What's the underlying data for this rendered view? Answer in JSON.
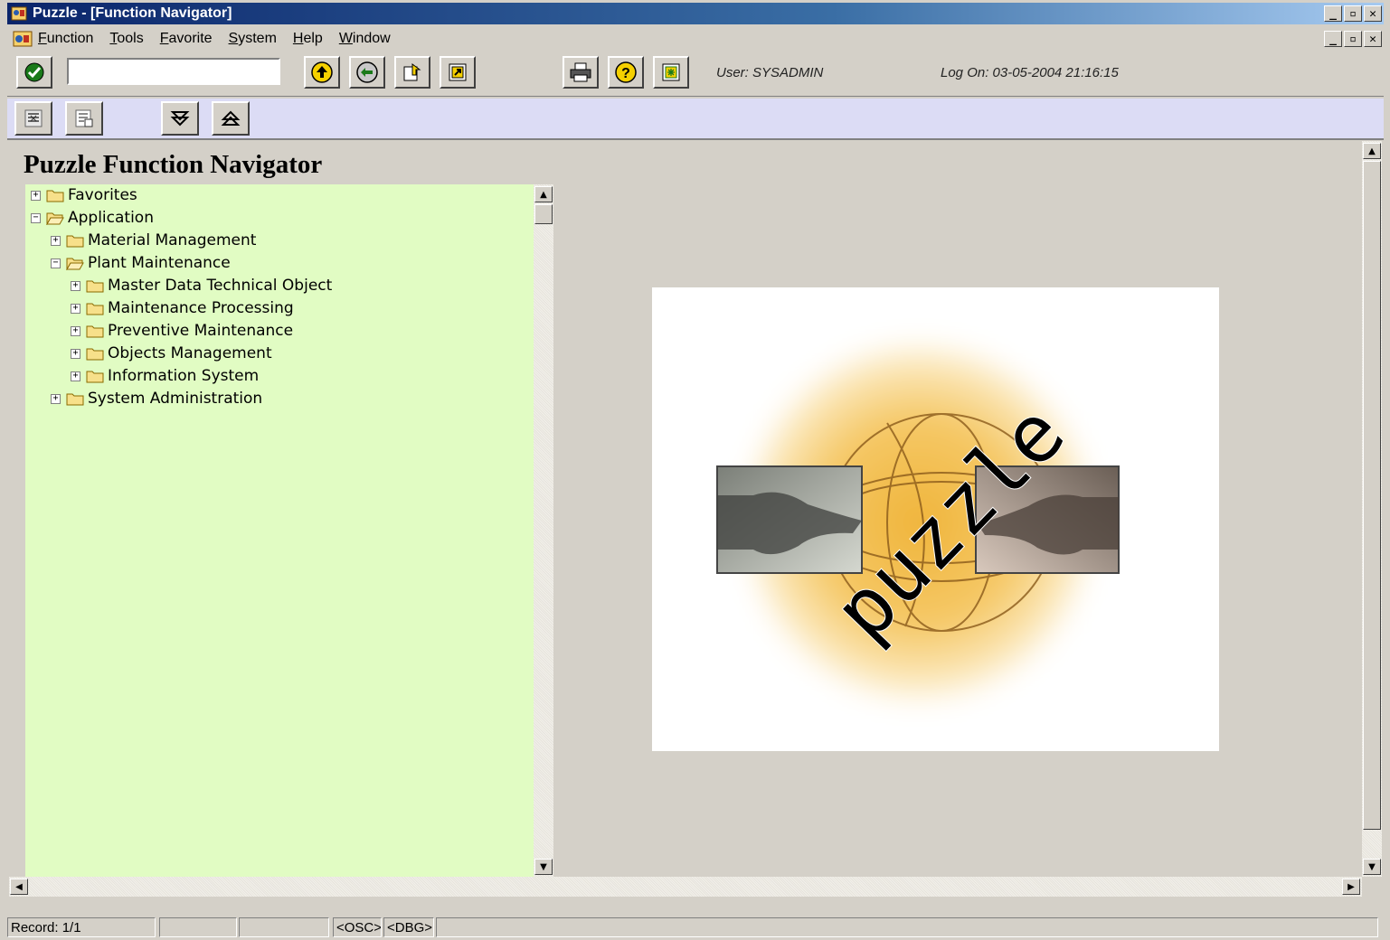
{
  "window": {
    "title": "Puzzle - [Function Navigator]"
  },
  "menu": {
    "items": [
      {
        "accel": "F",
        "rest": "unction"
      },
      {
        "accel": "T",
        "rest": "ools"
      },
      {
        "accel": "F",
        "rest": "avorite"
      },
      {
        "accel": "S",
        "rest": "ystem"
      },
      {
        "accel": "H",
        "rest": "elp"
      },
      {
        "accel": "W",
        "rest": "indow"
      }
    ]
  },
  "toolbar": {
    "command_value": "",
    "user_text": "User:  SYSADMIN",
    "logon_text": "Log On: 03-05-2004 21:16:15",
    "icons": [
      "check-icon",
      "back-icon",
      "exit-icon",
      "export-icon",
      "shortcut-icon",
      "print-icon",
      "help-icon",
      "layout-icon"
    ]
  },
  "app_toolbar": {
    "icons": [
      "select-all-icon",
      "deselect-icon",
      "expand-icon",
      "collapse-icon"
    ]
  },
  "page": {
    "title": "Puzzle Function Navigator"
  },
  "tree": {
    "nodes": [
      {
        "label": "Favorites",
        "level": 0,
        "expanded": false
      },
      {
        "label": "Application",
        "level": 0,
        "expanded": true
      },
      {
        "label": "Material Management",
        "level": 1,
        "expanded": false
      },
      {
        "label": "Plant Maintenance",
        "level": 1,
        "expanded": true
      },
      {
        "label": "Master Data Technical Object",
        "level": 2,
        "expanded": false
      },
      {
        "label": "Maintenance Processing",
        "level": 2,
        "expanded": false
      },
      {
        "label": "Preventive Maintenance",
        "level": 2,
        "expanded": false
      },
      {
        "label": "Objects Management",
        "level": 2,
        "expanded": false
      },
      {
        "label": "Information System",
        "level": 2,
        "expanded": false
      },
      {
        "label": "System Administration",
        "level": 1,
        "expanded": false
      }
    ]
  },
  "logo": {
    "text": "puzzle"
  },
  "status": {
    "record": "Record: 1/1",
    "cell2": "",
    "cell3": "",
    "osc": "<OSC>",
    "dbg": "<DBG>"
  },
  "colors": {
    "tree_bg": "#e1fcc3",
    "app_toolbar_bg": "#dcdcf5",
    "title_bar": "#0a246a"
  }
}
